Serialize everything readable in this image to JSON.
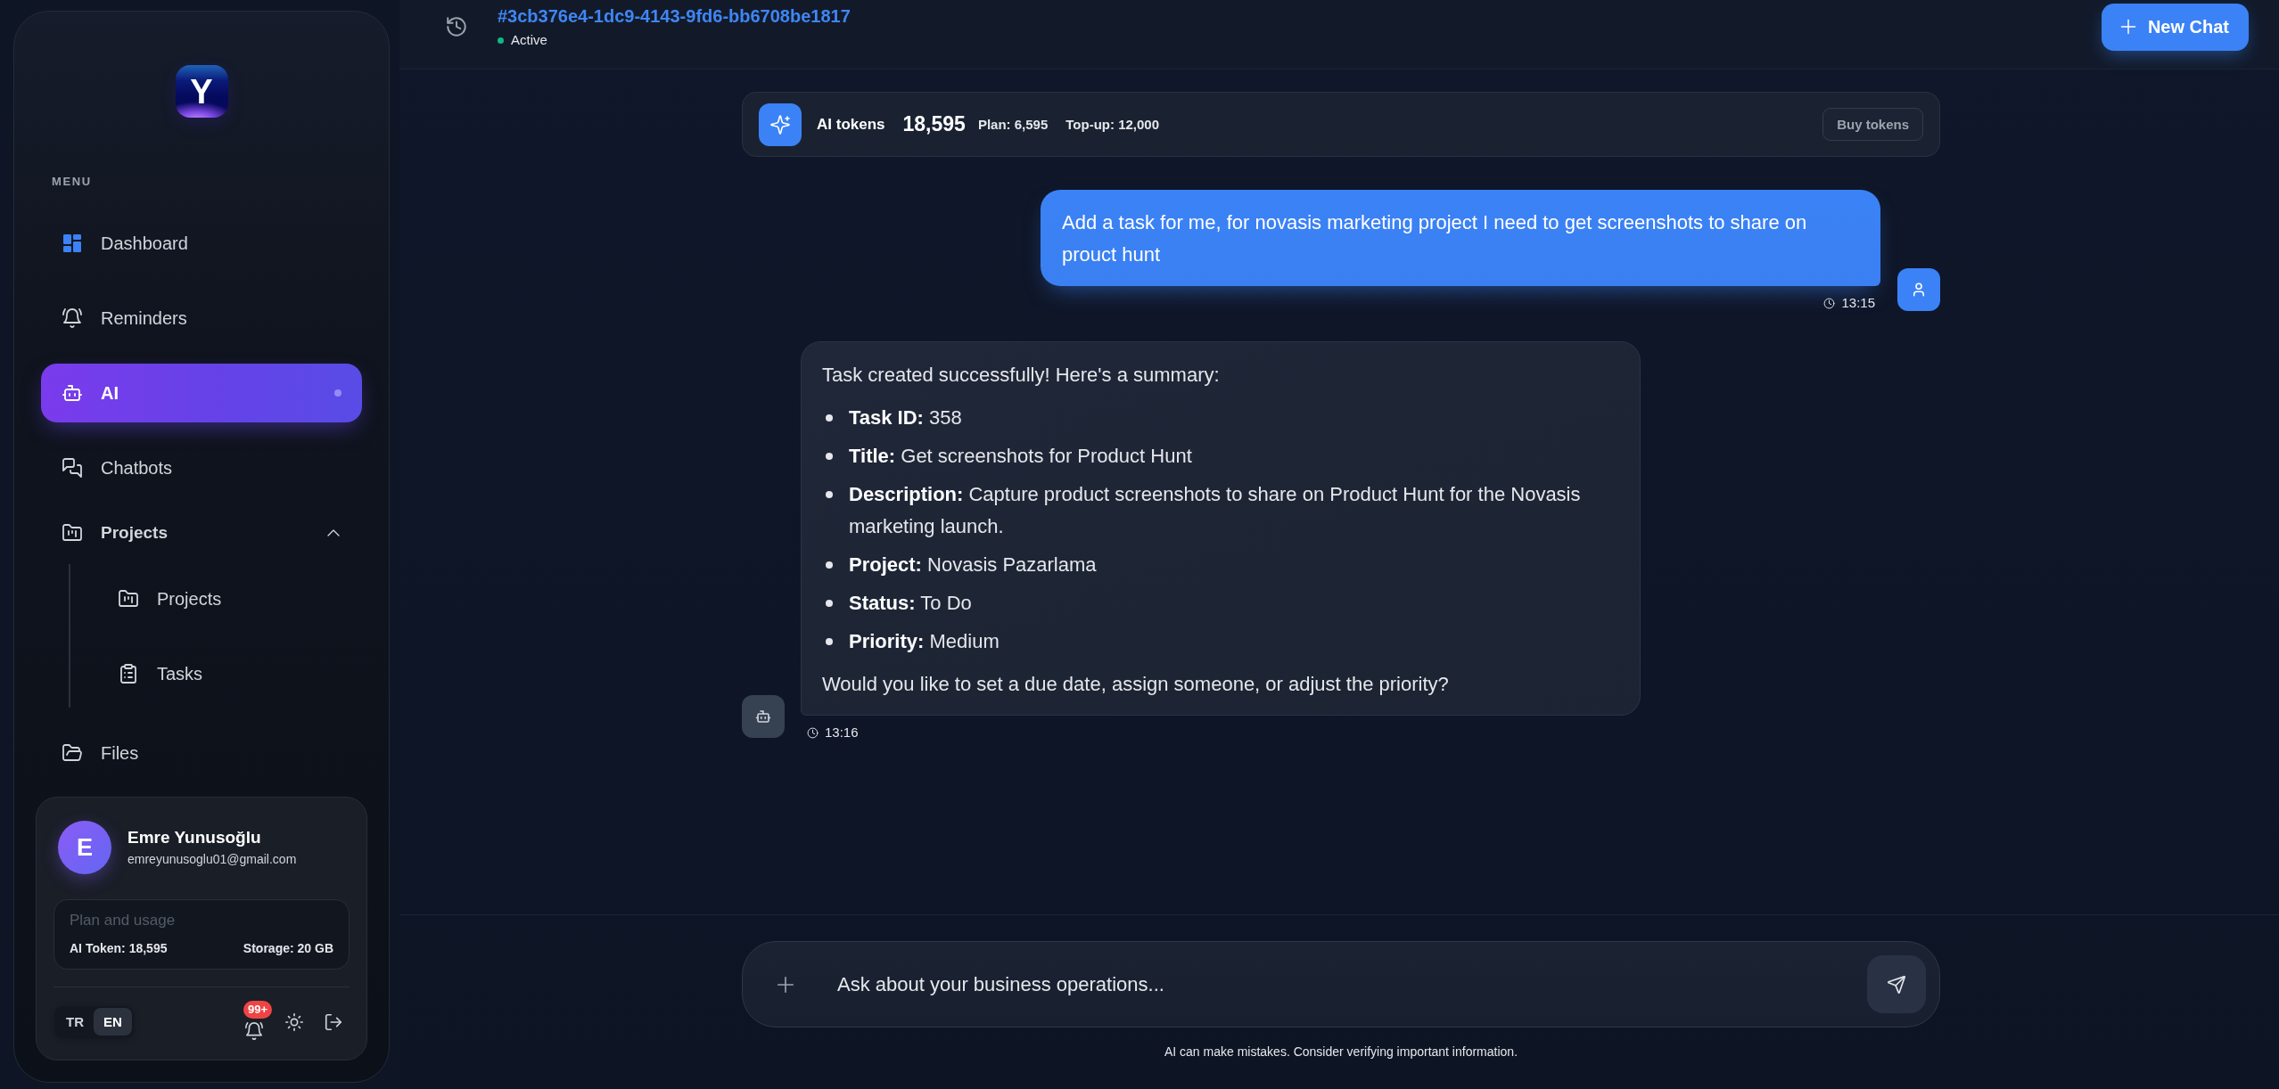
{
  "sidebar": {
    "logo": "Y",
    "menu_label": "MENU",
    "items": [
      {
        "kind": "link",
        "label": "Dashboard",
        "selected": false
      },
      {
        "kind": "link",
        "label": "Reminders",
        "selected": false
      },
      {
        "kind": "link",
        "label": "AI",
        "selected": true
      },
      {
        "kind": "link",
        "label": "Chatbots",
        "selected": false
      },
      {
        "kind": "group",
        "label": "Projects",
        "selected": false,
        "expanded": true,
        "children": [
          {
            "label": "Projects",
            "selected": false
          },
          {
            "label": "Tasks",
            "selected": false
          }
        ]
      },
      {
        "kind": "link",
        "label": "Files",
        "selected": false
      }
    ],
    "user": {
      "avatar_letter": "E",
      "name": "Emre Yunusoğlu",
      "email": "emreyunusoglu01@gmail.com"
    },
    "usage": {
      "title": "Plan and usage",
      "ai_token": "AI Token: 18,595",
      "storage": "Storage: 20 GB"
    },
    "languages": [
      {
        "label": "TR",
        "selected": false
      },
      {
        "label": "EN",
        "selected": true
      }
    ],
    "notification_badge": "99+"
  },
  "header": {
    "chat_id": "#3cb376e4-1dc9-4143-9fd6-bb6708be1817",
    "status": "Active",
    "new_chat_button": "New Chat"
  },
  "token_bar": {
    "label": "AI tokens",
    "total": "18,595",
    "plan": "Plan: 6,595",
    "topup": "Top-up: 12,000",
    "buy_button": "Buy tokens"
  },
  "messages": [
    {
      "kind": "user",
      "text": "Add a task for me, for novasis marketing project I need to get screenshots to share on prouct hunt",
      "time": "13:15"
    },
    {
      "kind": "assistant",
      "blocks": [
        {
          "kind": "paragraph",
          "text": "Task created successfully! Here's a summary:"
        },
        {
          "kind": "list",
          "items": [
            "**Task ID:** 358",
            "**Title:** Get screenshots for Product Hunt",
            "**Description:** Capture product screenshots to share on Product Hunt for the Novasis marketing launch.",
            "**Project:** Novasis Pazarlama",
            "**Status:** To Do",
            "**Priority:** Medium"
          ]
        },
        {
          "kind": "paragraph",
          "text": "Would you like to set a due date, assign someone, or adjust the priority?"
        }
      ],
      "time": "13:16"
    }
  ],
  "composer": {
    "placeholder": "Ask about your business operations...",
    "disclaimer": "AI can make mistakes. Consider verifying important information."
  }
}
